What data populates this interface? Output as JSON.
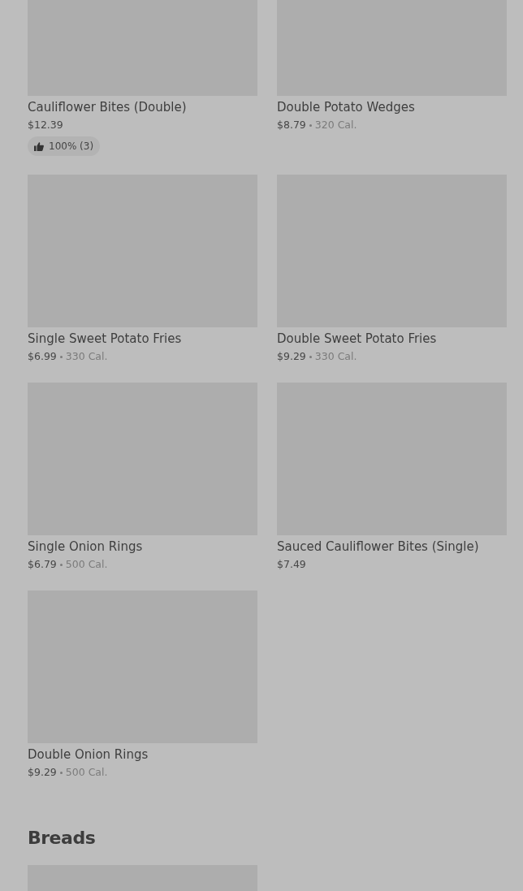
{
  "sections": [
    {
      "items": [
        {
          "kind": "full",
          "name": "Cauliflower Bites (Double)",
          "price": "$12.39",
          "rating": "100% (3)"
        },
        {
          "kind": "full",
          "name": "Double Potato Wedges",
          "price": "$8.79",
          "calories": "320 Cal."
        },
        {
          "kind": "full",
          "name": "Single Sweet Potato Fries",
          "price": "$6.99",
          "calories": "330 Cal."
        },
        {
          "kind": "full",
          "name": "Double Sweet Potato Fries",
          "price": "$9.29",
          "calories": "330 Cal."
        },
        {
          "kind": "full",
          "name": "Single Onion Rings",
          "price": "$6.79",
          "calories": "500 Cal."
        },
        {
          "kind": "full",
          "name": "Sauced Cauliflower Bites (Single)",
          "price": "$7.49"
        },
        {
          "kind": "full",
          "name": "Double Onion Rings",
          "price": "$9.29",
          "calories": "500 Cal."
        }
      ]
    },
    {
      "title": "Breads",
      "items": [
        {
          "kind": "image-only"
        }
      ]
    }
  ]
}
